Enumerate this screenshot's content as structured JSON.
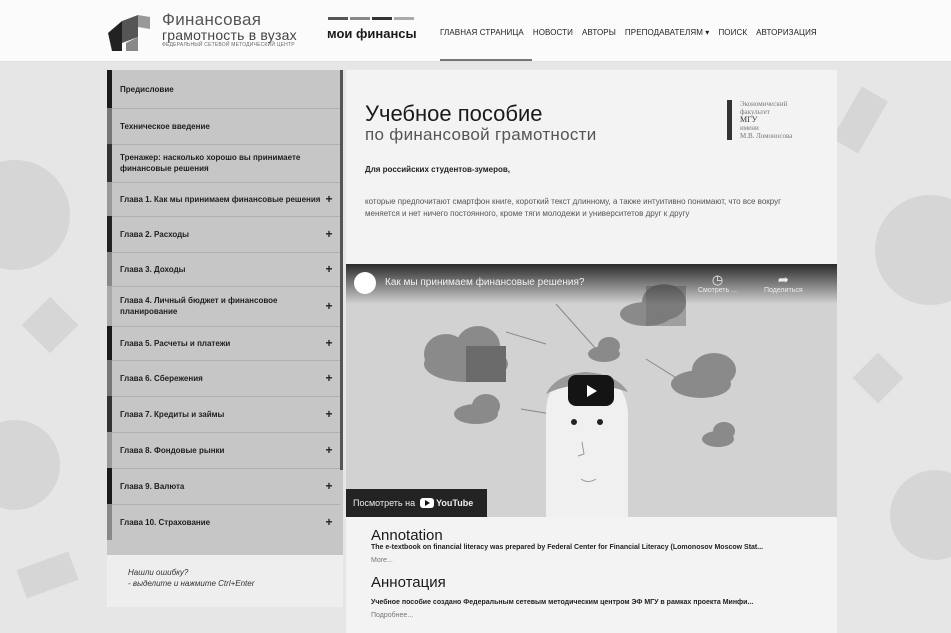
{
  "header": {
    "logo_line1": "Финансовая",
    "logo_line2": "грамотность в вузах",
    "logo_line3": "Федеральный сетевой методический центр",
    "brand_name": "мои финансы",
    "nav": [
      {
        "label": "ГЛАВНАЯ СТРАНИЦА"
      },
      {
        "label": "НОВОСТИ"
      },
      {
        "label": "АВТОРЫ"
      },
      {
        "label": "ПРЕПОДАВАТЕЛЯМ"
      },
      {
        "label": "ПОИСК"
      },
      {
        "label": "АВТОРИЗАЦИЯ"
      }
    ]
  },
  "sidebar": {
    "items": [
      {
        "label": "Предисловие",
        "expandable": false
      },
      {
        "label": "Техническое введение",
        "expandable": false
      },
      {
        "label": "Тренажер: насколько хорошо вы принимаете финансовые решения",
        "expandable": false
      },
      {
        "label": "Глава 1. Как мы принимаем финансовые решения",
        "expandable": true
      },
      {
        "label": "Глава 2. Расходы",
        "expandable": true
      },
      {
        "label": "Глава 3. Доходы",
        "expandable": true
      },
      {
        "label": "Глава 4. Личный бюджет и финансовое планирование",
        "expandable": true
      },
      {
        "label": "Глава 5. Расчеты и платежи",
        "expandable": true
      },
      {
        "label": "Глава 6. Сбережения",
        "expandable": true
      },
      {
        "label": "Глава 7. Кредиты и займы",
        "expandable": true
      },
      {
        "label": "Глава 8. Фондовые рынки",
        "expandable": true
      },
      {
        "label": "Глава 9. Валюта",
        "expandable": true
      },
      {
        "label": "Глава 10. Страхование",
        "expandable": true
      }
    ],
    "footer_line1": "Нашли ошибку?",
    "footer_line2": "- выделите и нажмите Ctrl+Enter"
  },
  "main": {
    "title1": "Учебное пособие",
    "title2": "по финансовой грамотности",
    "univ": {
      "line1": "Экономический",
      "line2": "факультет",
      "line3": "МГУ",
      "line4": "имени",
      "line5": "М.В. Ломоносова"
    },
    "subtitle": "Для российских студентов-зумеров,",
    "description": "которые предпочитают смартфон книге, короткий текст длинному, а также интуитивно понимают, что все вокруг меняется и нет ничего постоянного, кроме тяги молодежи и университетов друг к другу"
  },
  "video": {
    "title": "Как мы принимаем финансовые решения?",
    "watch_later": "Смотреть ...",
    "share": "Поделиться",
    "watch_on": "Посмотреть на",
    "youtube": "YouTube"
  },
  "annotation_en": {
    "heading": "Annotation",
    "text": "The e-textbook on financial literacy was prepared by Federal Center for Financial Literacy (Lomonosov Moscow Stat...",
    "more": "More..."
  },
  "annotation_ru": {
    "heading": "Аннотация",
    "text": "Учебное пособие создано Федеральным сетевым методическим центром ЭФ МГУ в рамках проекта Минфи...",
    "more": "Подробнее..."
  },
  "colors": {
    "sidebar_bg": "#c6c6c6",
    "accent_dark": "#1a1a1a",
    "accent_mid": "#777777"
  }
}
